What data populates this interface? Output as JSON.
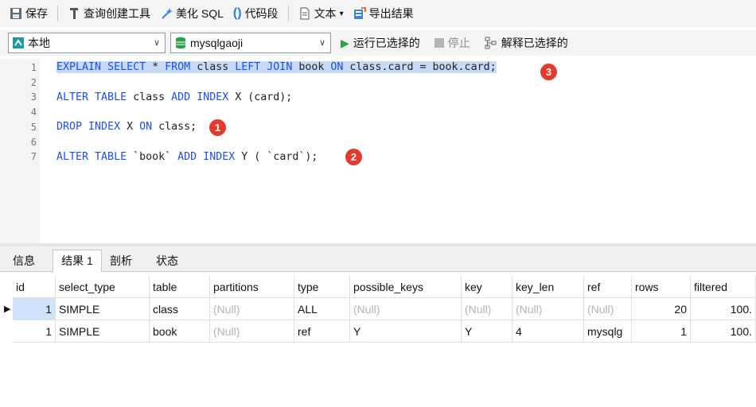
{
  "toolbar1": {
    "save": "保存",
    "query_builder": "查询创建工具",
    "beautify": "美化 SQL",
    "snippet": "代码段",
    "text": "文本",
    "export": "导出结果"
  },
  "toolbar2": {
    "connection": "本地",
    "database": "mysqlgaoji",
    "run_selected": "运行已选择的",
    "stop": "停止",
    "explain_selected": "解释已选择的"
  },
  "editor": {
    "line_numbers": [
      "1",
      "2",
      "3",
      "4",
      "5",
      "6",
      "7"
    ],
    "lines": [
      "EXPLAIN SELECT * FROM class LEFT JOIN book ON class.card = book.card;",
      "",
      "ALTER TABLE class ADD INDEX X (card);",
      "",
      "DROP INDEX X ON class;",
      "",
      "ALTER TABLE `book` ADD INDEX Y ( `card`);"
    ],
    "badges": [
      "1",
      "2",
      "3"
    ]
  },
  "tabs": [
    "信息",
    "结果 1",
    "剖析",
    "状态"
  ],
  "grid": {
    "columns": [
      "id",
      "select_type",
      "table",
      "partitions",
      "type",
      "possible_keys",
      "key",
      "key_len",
      "ref",
      "rows",
      "filtered"
    ],
    "rows": [
      [
        "1",
        "SIMPLE",
        "class",
        "(Null)",
        "ALL",
        "(Null)",
        "(Null)",
        "(Null)",
        "(Null)",
        "20",
        "100."
      ],
      [
        "1",
        "SIMPLE",
        "book",
        "(Null)",
        "ref",
        "Y",
        "Y",
        "4",
        "mysqlg",
        "1",
        "100."
      ]
    ]
  },
  "colors": {
    "keyword": "#1c4ef0",
    "badge": "#e43a2d",
    "selection": "#c7daf5"
  }
}
